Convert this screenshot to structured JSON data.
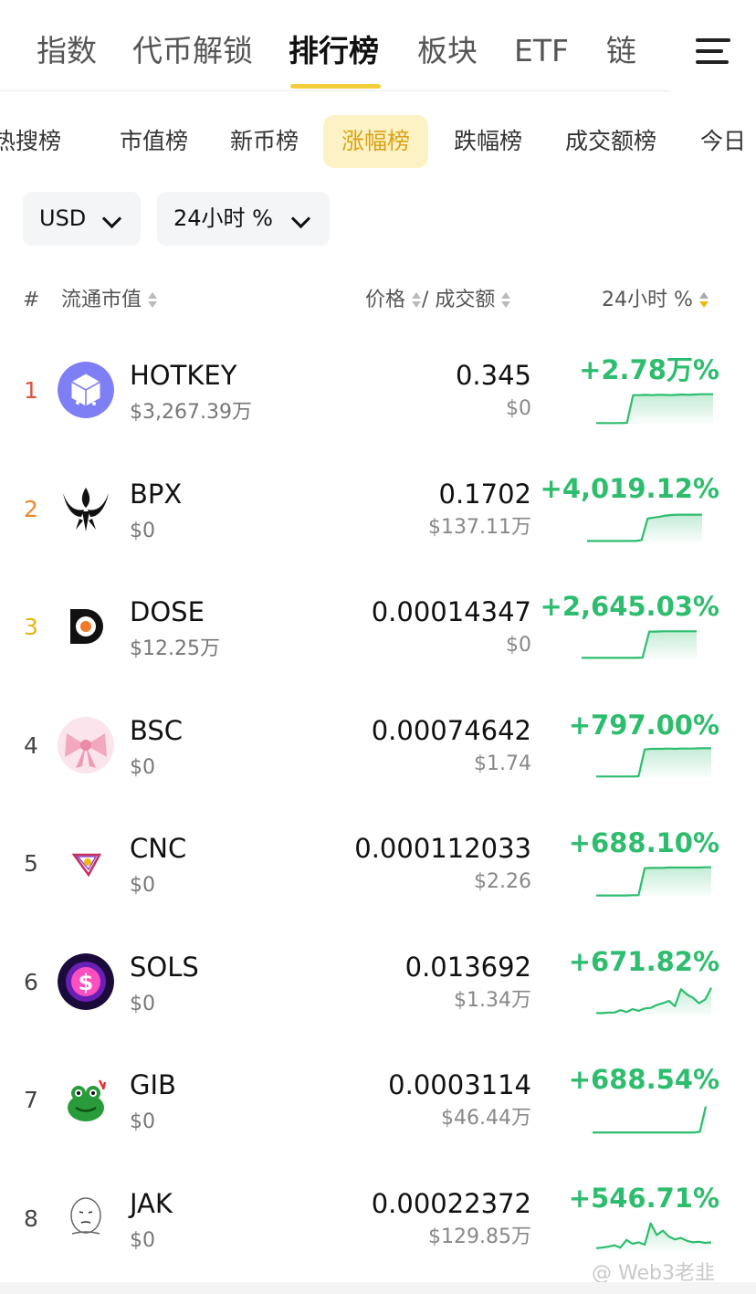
{
  "top_tabs": [
    "指数",
    "代币解锁",
    "排行榜",
    "板块",
    "ETF",
    "链"
  ],
  "top_active_tab": "排行榜",
  "sub_tabs": [
    "热搜榜",
    "市值榜",
    "新币榜",
    "涨幅榜",
    "跌幅榜",
    "成交额榜",
    "今日"
  ],
  "sub_active_tab": "涨幅榜",
  "filters": {
    "currency": "USD",
    "period": "24小时 %"
  },
  "table_header": {
    "rank": "#",
    "market_cap": "流通市值",
    "price": "价格",
    "volume": "/ 成交额",
    "change": "24小时 %"
  },
  "colors": {
    "accent_yellow": "#f5cf3b",
    "up_green": "#2ebd6e",
    "rank1": "#e0523d",
    "rank2": "#f0882a",
    "rank3": "#e7b511"
  },
  "rows": [
    {
      "rank": "1",
      "symbol": "HOTKEY",
      "market_cap": "$3,267.39万",
      "price": "0.345",
      "volume": "$0",
      "change": "+2.78万%",
      "icon": "hotkey-cube-icon",
      "spark": [
        0.02,
        0.02,
        0.02,
        0.02,
        0.02,
        0.03,
        0.92,
        0.92,
        0.93,
        0.92,
        0.93,
        0.93,
        0.92,
        0.93,
        0.94,
        0.93,
        0.94,
        0.95,
        0.95,
        0.95
      ]
    },
    {
      "rank": "2",
      "symbol": "BPX",
      "market_cap": "$0",
      "price": "0.1702",
      "volume": "$137.11万",
      "change": "+4,019.12%",
      "icon": "phoenix-icon",
      "spark": [
        0.05,
        0.05,
        0.05,
        0.05,
        0.05,
        0.05,
        0.05,
        0.05,
        0.05,
        0.08,
        0.82,
        0.85,
        0.88,
        0.92,
        0.94,
        0.95,
        0.95,
        0.95,
        0.95,
        0.95
      ]
    },
    {
      "rank": "3",
      "symbol": "DOSE",
      "market_cap": "$12.25万",
      "price": "0.00014347",
      "volume": "$0",
      "change": "+2,645.03%",
      "icon": "dose-icon",
      "spark": [
        0.05,
        0.05,
        0.05,
        0.05,
        0.05,
        0.05,
        0.05,
        0.05,
        0.05,
        0.06,
        0.95,
        0.95,
        0.96,
        0.96,
        0.96,
        0.96,
        0.96,
        0.96
      ]
    },
    {
      "rank": "4",
      "symbol": "BSC",
      "market_cap": "$0",
      "price": "0.00074642",
      "volume": "$1.74",
      "change": "+797.00%",
      "icon": "bow-icon",
      "spark": [
        0.05,
        0.05,
        0.05,
        0.05,
        0.05,
        0.05,
        0.05,
        0.06,
        0.92,
        0.94,
        0.94,
        0.94,
        0.95,
        0.94,
        0.95,
        0.95,
        0.95,
        0.96,
        0.96,
        0.96
      ]
    },
    {
      "rank": "5",
      "symbol": "CNC",
      "market_cap": "$0",
      "price": "0.000112033",
      "volume": "$2.26",
      "change": "+688.10%",
      "icon": "cnc-triangle-icon",
      "spark": [
        0.04,
        0.04,
        0.04,
        0.04,
        0.04,
        0.04,
        0.05,
        0.05,
        0.92,
        0.93,
        0.93,
        0.93,
        0.94,
        0.94,
        0.94,
        0.94,
        0.94,
        0.94,
        0.95,
        0.95
      ]
    },
    {
      "rank": "6",
      "symbol": "SOLS",
      "market_cap": "$0",
      "price": "0.013692",
      "volume": "$1.34万",
      "change": "+671.82%",
      "icon": "sols-dollar-icon",
      "spark": [
        0.08,
        0.08,
        0.1,
        0.1,
        0.18,
        0.12,
        0.22,
        0.16,
        0.24,
        0.26,
        0.36,
        0.42,
        0.5,
        0.32,
        0.9,
        0.72,
        0.6,
        0.42,
        0.55,
        0.95
      ]
    },
    {
      "rank": "7",
      "symbol": "GIB",
      "market_cap": "$0",
      "price": "0.0003114",
      "volume": "$46.44万",
      "change": "+688.54%",
      "icon": "frog-icon",
      "spark": [
        0.06,
        0.06,
        0.06,
        0.06,
        0.06,
        0.06,
        0.06,
        0.06,
        0.06,
        0.06,
        0.06,
        0.06,
        0.06,
        0.06,
        0.06,
        0.06,
        0.06,
        0.06,
        0.08,
        0.95
      ]
    },
    {
      "rank": "8",
      "symbol": "JAK",
      "market_cap": "$0",
      "price": "0.00022372",
      "volume": "$129.85万",
      "change": "+546.71%",
      "icon": "wojak-icon",
      "spark": [
        0.1,
        0.12,
        0.15,
        0.2,
        0.12,
        0.38,
        0.25,
        0.3,
        0.22,
        0.95,
        0.55,
        0.7,
        0.5,
        0.4,
        0.45,
        0.35,
        0.3,
        0.32,
        0.28,
        0.3
      ]
    }
  ],
  "watermark": "@ Web3老韭"
}
